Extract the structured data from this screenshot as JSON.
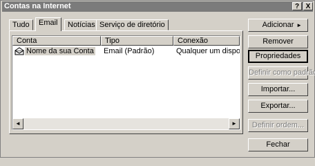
{
  "window": {
    "title": "Contas na Internet",
    "help_glyph": "?",
    "close_glyph": "X"
  },
  "tabs": [
    {
      "label": "Tudo",
      "active": false
    },
    {
      "label": "Email",
      "active": true
    },
    {
      "label": "Notícias",
      "active": false
    },
    {
      "label": "Serviço de diretório",
      "active": false
    }
  ],
  "list": {
    "columns": [
      "Conta",
      "Tipo",
      "Conexão"
    ],
    "rows": [
      {
        "conta": "Nome da sua Conta",
        "tipo": "Email (Padrão)",
        "conexao": "Qualquer um dispo...",
        "icon": "mail-account-icon",
        "selected": true
      }
    ],
    "scroll_left_glyph": "◄",
    "scroll_right_glyph": "►"
  },
  "buttons": {
    "adicionar": "Adicionar",
    "adicionar_arrow": "►",
    "remover": "Remover",
    "propriedades": "Propriedades",
    "definir_padrao": "Definir como padrão",
    "importar": "Importar...",
    "exportar": "Exportar...",
    "definir_ordem": "Definir ordem...",
    "fechar": "Fechar"
  },
  "colors": {
    "face": "#d4d0c8",
    "titlebar": "#7b7b7b",
    "disabled_text": "#808080"
  }
}
